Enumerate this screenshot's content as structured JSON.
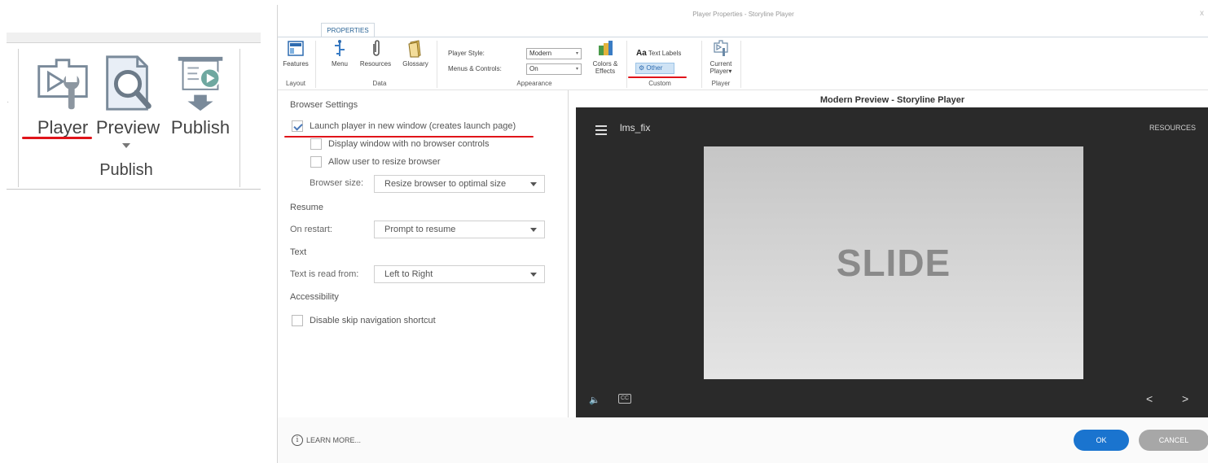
{
  "left_ribbon": {
    "buttons": [
      {
        "label": "Player",
        "icon": "player-wrench-icon"
      },
      {
        "label": "Preview",
        "icon": "preview-magnifier-icon"
      },
      {
        "label": "Publish",
        "icon": "publish-projector-icon"
      }
    ],
    "group_label": "Publish"
  },
  "dialog": {
    "title": "Player Properties - Storyline Player",
    "close_glyph": "x",
    "tab": "PROPERTIES",
    "ribbon": {
      "layout": {
        "features_label": "Features",
        "group": "Layout"
      },
      "data": {
        "menu_label": "Menu",
        "resources_label": "Resources",
        "glossary_label": "Glossary",
        "group": "Data"
      },
      "appearance": {
        "player_style_label": "Player Style:",
        "player_style_value": "Modern",
        "menus_controls_label": "Menus & Controls:",
        "menus_controls_value": "On",
        "colors_label_1": "Colors &",
        "colors_label_2": "Effects",
        "group": "Appearance"
      },
      "custom": {
        "text_labels_prefix": "Aa",
        "text_labels": "Text Labels",
        "other": "Other",
        "group": "Custom"
      },
      "player": {
        "current_label_1": "Current",
        "current_label_2": "Player",
        "group": "Player"
      }
    },
    "settings": {
      "browser_heading": "Browser Settings",
      "launch_new_window": "Launch player in new window (creates launch page)",
      "launch_checked": true,
      "no_browser_controls": "Display window with no browser controls",
      "allow_resize": "Allow user to resize browser",
      "browser_size_label": "Browser size:",
      "browser_size_value": "Resize browser to optimal size",
      "resume_heading": "Resume",
      "on_restart_label": "On restart:",
      "on_restart_value": "Prompt to resume",
      "text_heading": "Text",
      "text_read_label": "Text is read from:",
      "text_read_value": "Left to Right",
      "accessibility_heading": "Accessibility",
      "disable_skip_nav": "Disable skip navigation shortcut"
    },
    "preview": {
      "title": "Modern Preview - Storyline Player",
      "course_title": "lms_fix",
      "resources": "RESOURCES",
      "slide_text": "SLIDE",
      "prev_glyph": "<",
      "next_glyph": ">"
    },
    "footer": {
      "learn_more": "LEARN MORE...",
      "ok": "OK",
      "cancel": "CANCEL"
    }
  },
  "colors": {
    "accent_blue": "#1a74cf",
    "highlight_red": "#e0141a",
    "cancel_gray": "#a7a7a7",
    "preview_bg": "#2a2a2a"
  }
}
